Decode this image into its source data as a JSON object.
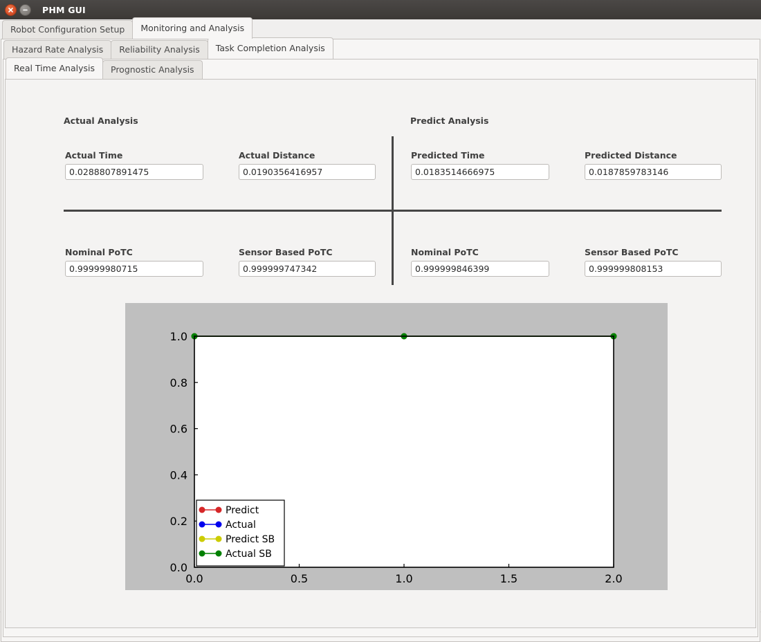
{
  "window": {
    "title": "PHM GUI",
    "close_icon": "close-icon",
    "minimize_icon": "minimize-icon"
  },
  "tabs_level1": [
    {
      "label": "Robot Configuration Setup",
      "active": false
    },
    {
      "label": "Monitoring and Analysis",
      "active": true
    }
  ],
  "tabs_level2": [
    {
      "label": "Hazard Rate Analysis",
      "active": false
    },
    {
      "label": "Reliability Analysis",
      "active": false
    },
    {
      "label": "Task Completion Analysis",
      "active": true
    }
  ],
  "tabs_level3": [
    {
      "label": "Real Time Analysis",
      "active": true
    },
    {
      "label": "Prognostic Analysis",
      "active": false
    }
  ],
  "panels": {
    "actual": {
      "heading": "Actual Analysis",
      "fields": [
        {
          "label": "Actual Time",
          "value": "0.0288807891475"
        },
        {
          "label": "Actual Distance",
          "value": "0.0190356416957"
        },
        {
          "label": "Nominal PoTC",
          "value": "0.99999980715"
        },
        {
          "label": "Sensor Based PoTC",
          "value": "0.999999747342"
        }
      ]
    },
    "predict": {
      "heading": "Predict Analysis",
      "fields": [
        {
          "label": "Predicted Time",
          "value": "0.0183514666975"
        },
        {
          "label": "Predicted Distance",
          "value": "0.0187859783146"
        },
        {
          "label": "Nominal PoTC",
          "value": "0.999999846399"
        },
        {
          "label": "Sensor Based PoTC",
          "value": "0.999999808153"
        }
      ]
    }
  },
  "chart_data": {
    "type": "line",
    "title": "",
    "xlabel": "",
    "ylabel": "",
    "xlim": [
      0.0,
      2.0
    ],
    "ylim": [
      0.0,
      1.0
    ],
    "xticks": [
      "0.0",
      "0.5",
      "1.0",
      "1.5",
      "2.0"
    ],
    "yticks": [
      "0.0",
      "0.2",
      "0.4",
      "0.6",
      "0.8",
      "1.0"
    ],
    "grid": false,
    "legend_position": "lower left",
    "facecolor": "#bfbfbf",
    "axes_facecolor": "#ffffff",
    "series": [
      {
        "name": "Predict",
        "color": "#d62728",
        "x": [
          0,
          1,
          2
        ],
        "y": [
          1.0,
          1.0,
          1.0
        ]
      },
      {
        "name": "Actual",
        "color": "#0000ee",
        "x": [
          0,
          1,
          2
        ],
        "y": [
          1.0,
          1.0,
          1.0
        ]
      },
      {
        "name": "Predict SB",
        "color": "#cccc00",
        "x": [
          0,
          1,
          2
        ],
        "y": [
          1.0,
          1.0,
          1.0
        ]
      },
      {
        "name": "Actual SB",
        "color": "#008000",
        "x": [
          0,
          1,
          2
        ],
        "y": [
          1.0,
          1.0,
          1.0
        ]
      }
    ]
  },
  "colors": {
    "titlebar": "#3c3936",
    "panel_bg": "#f4f3f2",
    "divider": "#454545",
    "chart_bg": "#bfbfbf"
  }
}
